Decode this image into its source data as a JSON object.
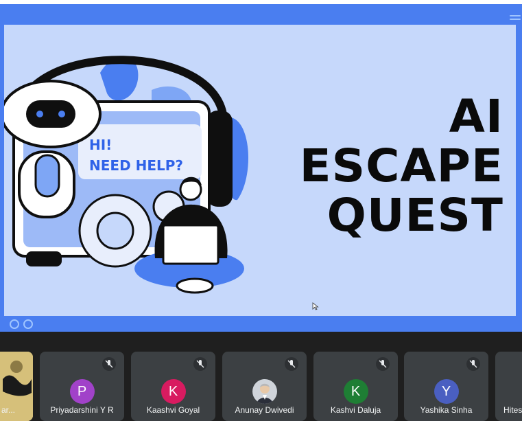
{
  "slide": {
    "bubble_line1": "HI!",
    "bubble_line2": "NEED HELP?",
    "title_line1": "AI",
    "title_line2": "ESCAPE",
    "title_line3": "QUEST"
  },
  "participants": [
    {
      "name": "ar...",
      "avatar": "photo"
    },
    {
      "name": "Priyadarshini Y R",
      "initial": "P",
      "color": "#a142c9"
    },
    {
      "name": "Kaashvi Goyal",
      "initial": "K",
      "color": "#d81b60"
    },
    {
      "name": "Anunay Dwivedi",
      "avatar": "photo"
    },
    {
      "name": "Kashvi Daluja",
      "initial": "K",
      "color": "#1e7e34"
    },
    {
      "name": "Yashika Sinha",
      "initial": "Y",
      "color": "#4a5fc1"
    },
    {
      "name": "Hites"
    }
  ],
  "colors": {
    "stage_blue": "#4a7ef0",
    "slide_bg": "#c6d8fb",
    "tile_bg": "#3c4043"
  }
}
